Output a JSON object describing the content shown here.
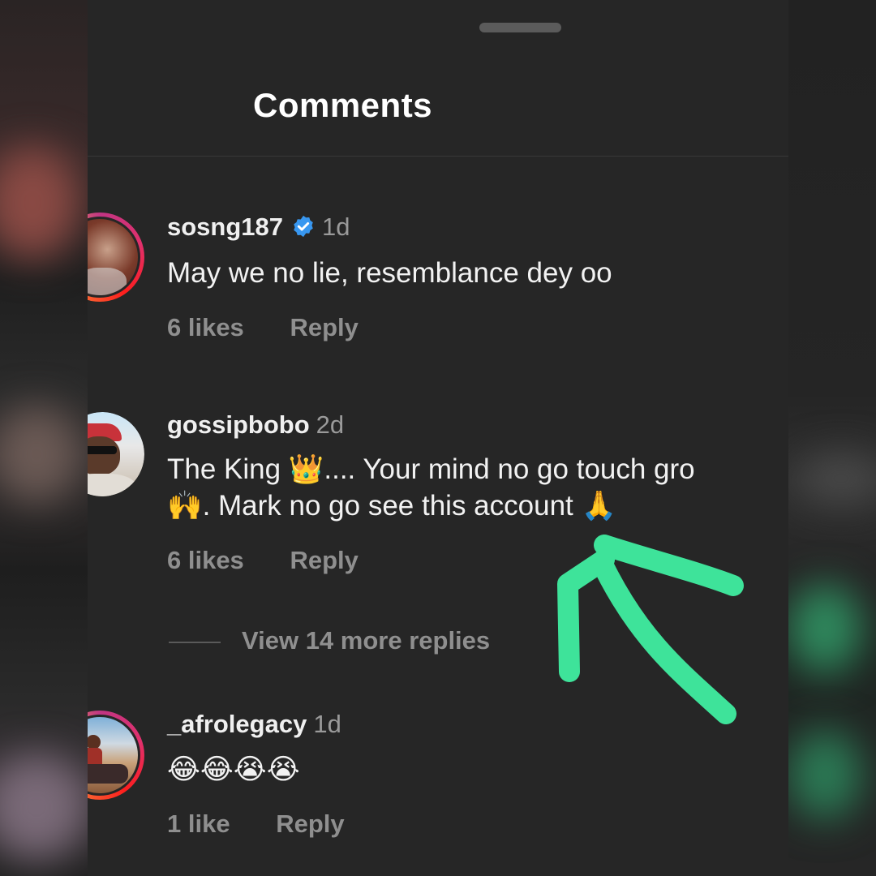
{
  "header": {
    "title": "Comments"
  },
  "comments": [
    {
      "username": "sosng187",
      "time": "1d",
      "verified": true,
      "text": "May we no lie, resemblance dey oo",
      "likes": "6 likes",
      "reply": "Reply"
    },
    {
      "username": "gossipbobo",
      "time": "2d",
      "verified": false,
      "text_line1": "The King 👑.... Your mind no go touch gro",
      "text_line2": "🙌. Mark no go see this account 🙏",
      "likes": "6 likes",
      "reply": "Reply",
      "view_replies": "View 14 more replies"
    },
    {
      "username": "_afrolegacy",
      "time": "1d",
      "verified": false,
      "text": "😂😂😭😭",
      "likes": "1 like",
      "reply": "Reply"
    }
  ],
  "annotation": {
    "color": "#3ee39a",
    "icon": "hand-drawn-arrow-icon"
  },
  "colors": {
    "background": "#262626",
    "verified": "#3897f0",
    "muted": "#8f8f8f"
  }
}
